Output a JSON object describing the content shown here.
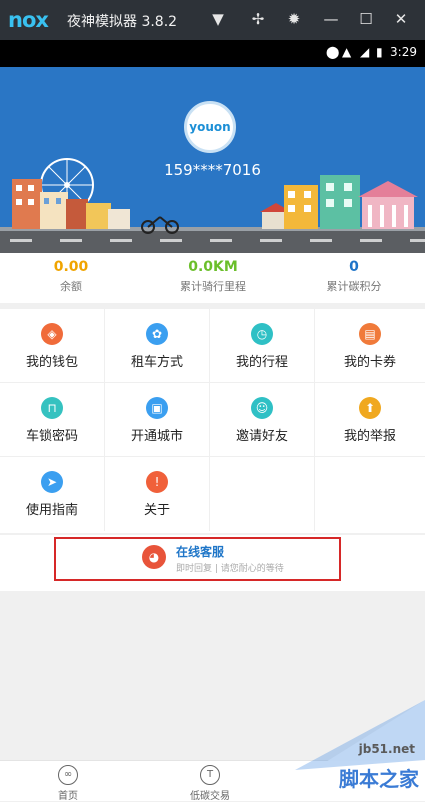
{
  "titlebar": {
    "logo": "nox",
    "title": "夜神模拟器 3.8.2"
  },
  "statusbar": {
    "time": "3:29"
  },
  "profile": {
    "avatar_text": "youon",
    "phone": "159****7016"
  },
  "stats": [
    {
      "value": "0.00",
      "label": "余额",
      "color": "#f0a400"
    },
    {
      "value": "0.0KM",
      "label": "累计骑行里程",
      "color": "#6bbf2b"
    },
    {
      "value": "0",
      "label": "累计碳积分",
      "color": "#1e73c8"
    }
  ],
  "menu": [
    {
      "label": "我的钱包",
      "icon": "wallet-icon",
      "color": "#f06b3a"
    },
    {
      "label": "租车方式",
      "icon": "rent-icon",
      "color": "#3b9ff0"
    },
    {
      "label": "我的行程",
      "icon": "trip-icon",
      "color": "#2fc0c5"
    },
    {
      "label": "我的卡券",
      "icon": "coupon-icon",
      "color": "#f07a3a"
    },
    {
      "label": "车锁密码",
      "icon": "lock-icon",
      "color": "#35c2c0"
    },
    {
      "label": "开通城市",
      "icon": "city-icon",
      "color": "#3b9ff0"
    },
    {
      "label": "邀请好友",
      "icon": "invite-icon",
      "color": "#2fc0c5"
    },
    {
      "label": "我的举报",
      "icon": "report-icon",
      "color": "#f0a81f"
    },
    {
      "label": "使用指南",
      "icon": "guide-icon",
      "color": "#3b9ff0"
    },
    {
      "label": "关于",
      "icon": "about-icon",
      "color": "#f0603a"
    }
  ],
  "service": {
    "title": "在线客服",
    "subtitle": "即时回复 | 请您耐心的等待"
  },
  "bottomnav": [
    {
      "label": "首页"
    },
    {
      "label": "低碳交易"
    }
  ],
  "watermark": {
    "url": "jb51.net",
    "text": "脚本之家"
  }
}
